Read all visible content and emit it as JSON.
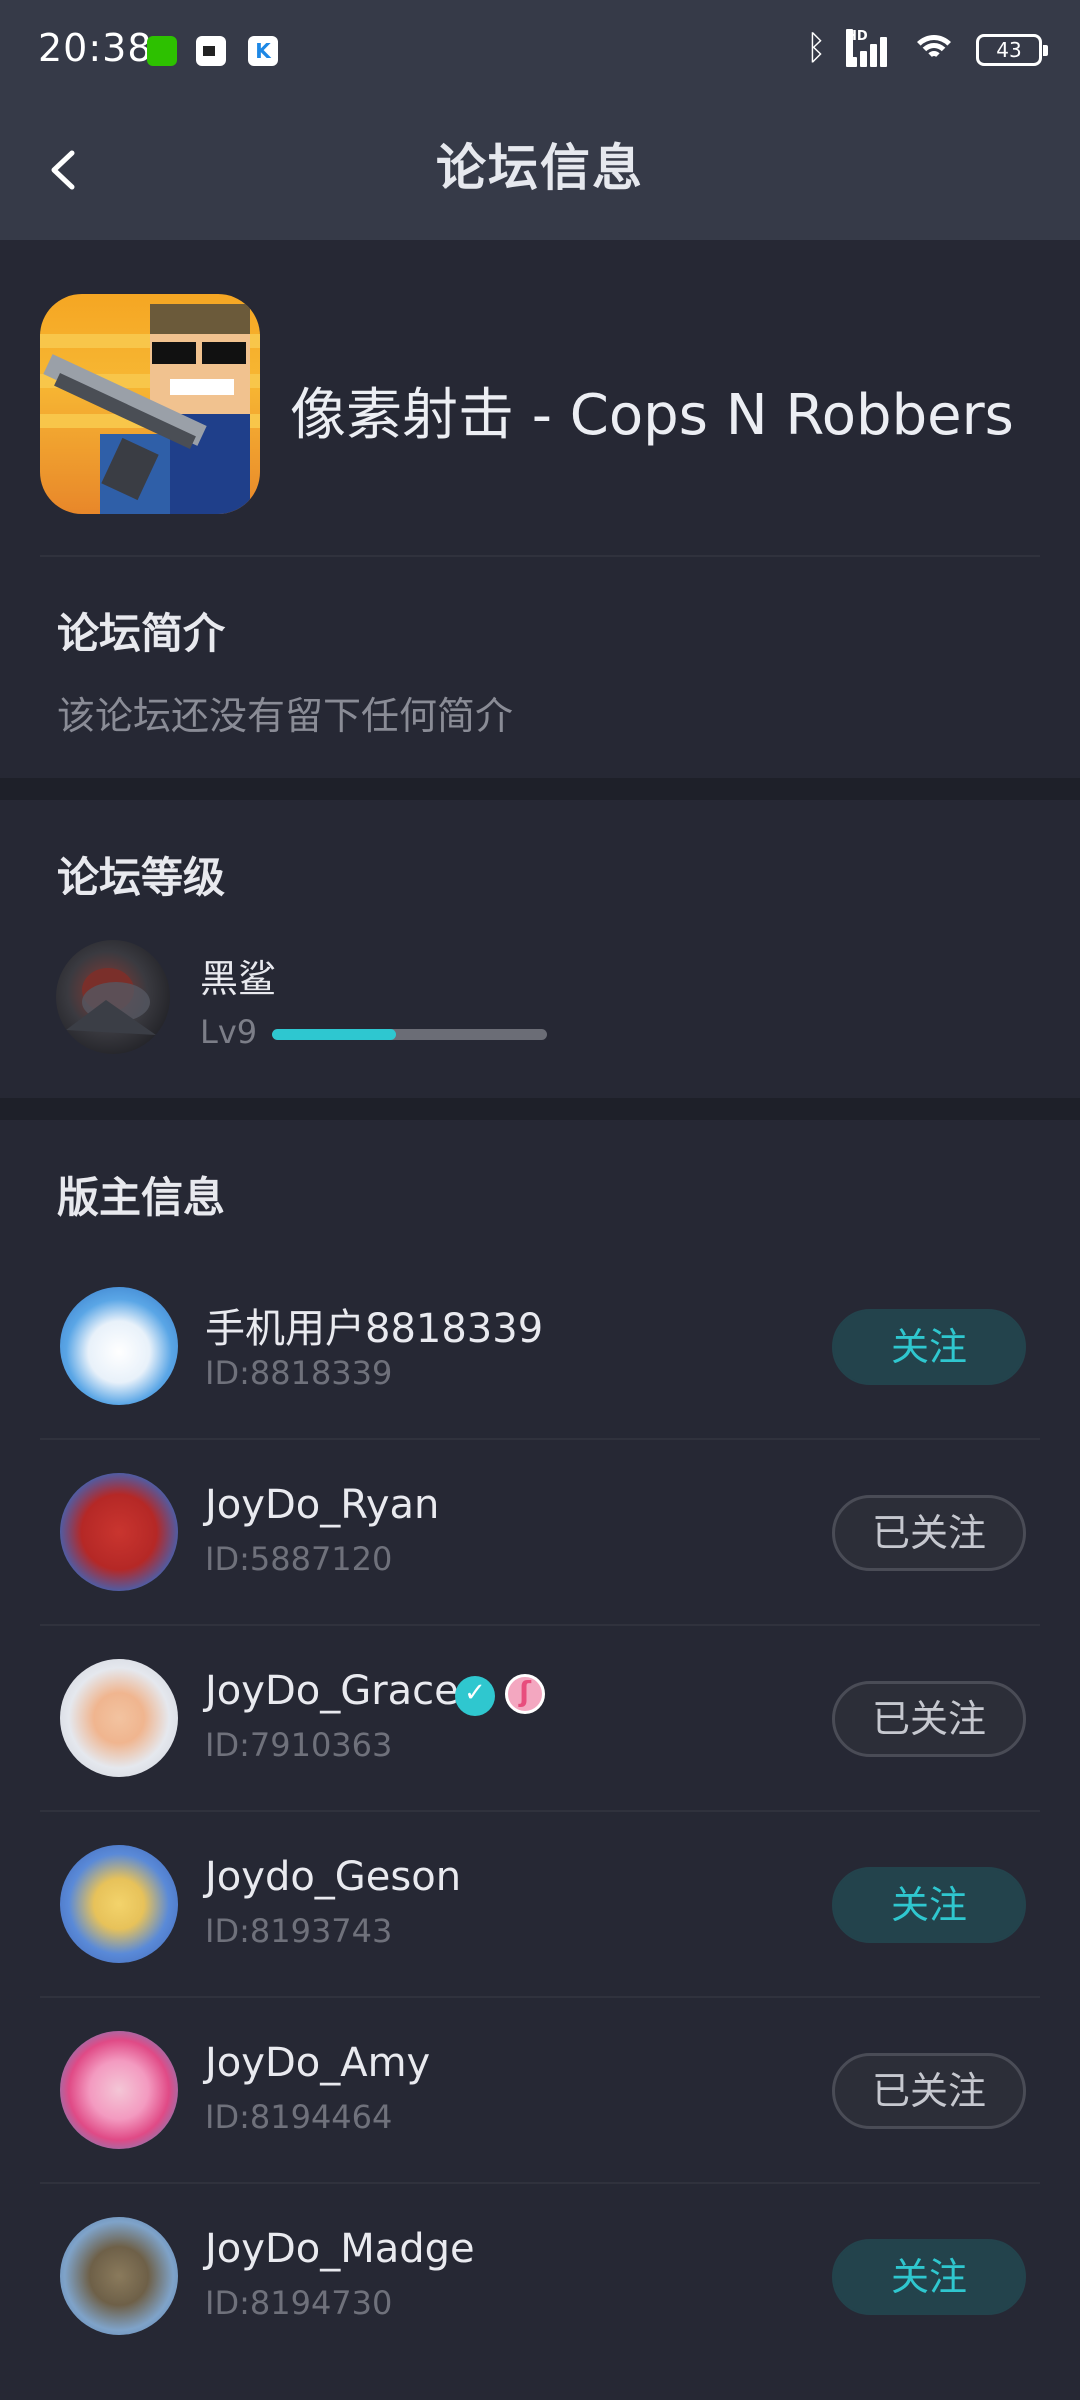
{
  "status_bar": {
    "time": "20:38",
    "battery": "43",
    "signal_label": "HD",
    "icons": [
      "wechat-icon",
      "video-icon",
      "k-app-icon",
      "bluetooth-icon",
      "signal-icon",
      "wifi-icon",
      "battery-icon"
    ]
  },
  "header": {
    "title": "论坛信息",
    "back_icon": "chevron-left-icon"
  },
  "game": {
    "title": "像素射击 - Cops N Robbers"
  },
  "intro": {
    "heading": "论坛简介",
    "text": "该论坛还没有留下任何简介"
  },
  "level": {
    "heading": "论坛等级",
    "name": "黑鲨",
    "tag": "Lv9",
    "progress": 0.45
  },
  "moderators": {
    "heading": "版主信息",
    "items": [
      {
        "name": "手机用户8818339",
        "id": "ID:8818339",
        "button": "关注",
        "state": "follow"
      },
      {
        "name": "JoyDo_Ryan",
        "id": "ID:5887120",
        "button": "已关注",
        "state": "followed"
      },
      {
        "name": "JoyDo_Grace",
        "id": "ID:7910363",
        "button": "已关注",
        "state": "followed"
      },
      {
        "name": "Joydo_Geson",
        "id": "ID:8193743",
        "button": "关注",
        "state": "follow"
      },
      {
        "name": "JoyDo_Amy",
        "id": "ID:8194464",
        "button": "已关注",
        "state": "followed"
      },
      {
        "name": "JoyDo_Madge",
        "id": "ID:8194730",
        "button": "关注",
        "state": "follow"
      }
    ]
  },
  "colors": {
    "accent": "#2fc7cf",
    "background": "#262834",
    "header": "#363a48"
  }
}
